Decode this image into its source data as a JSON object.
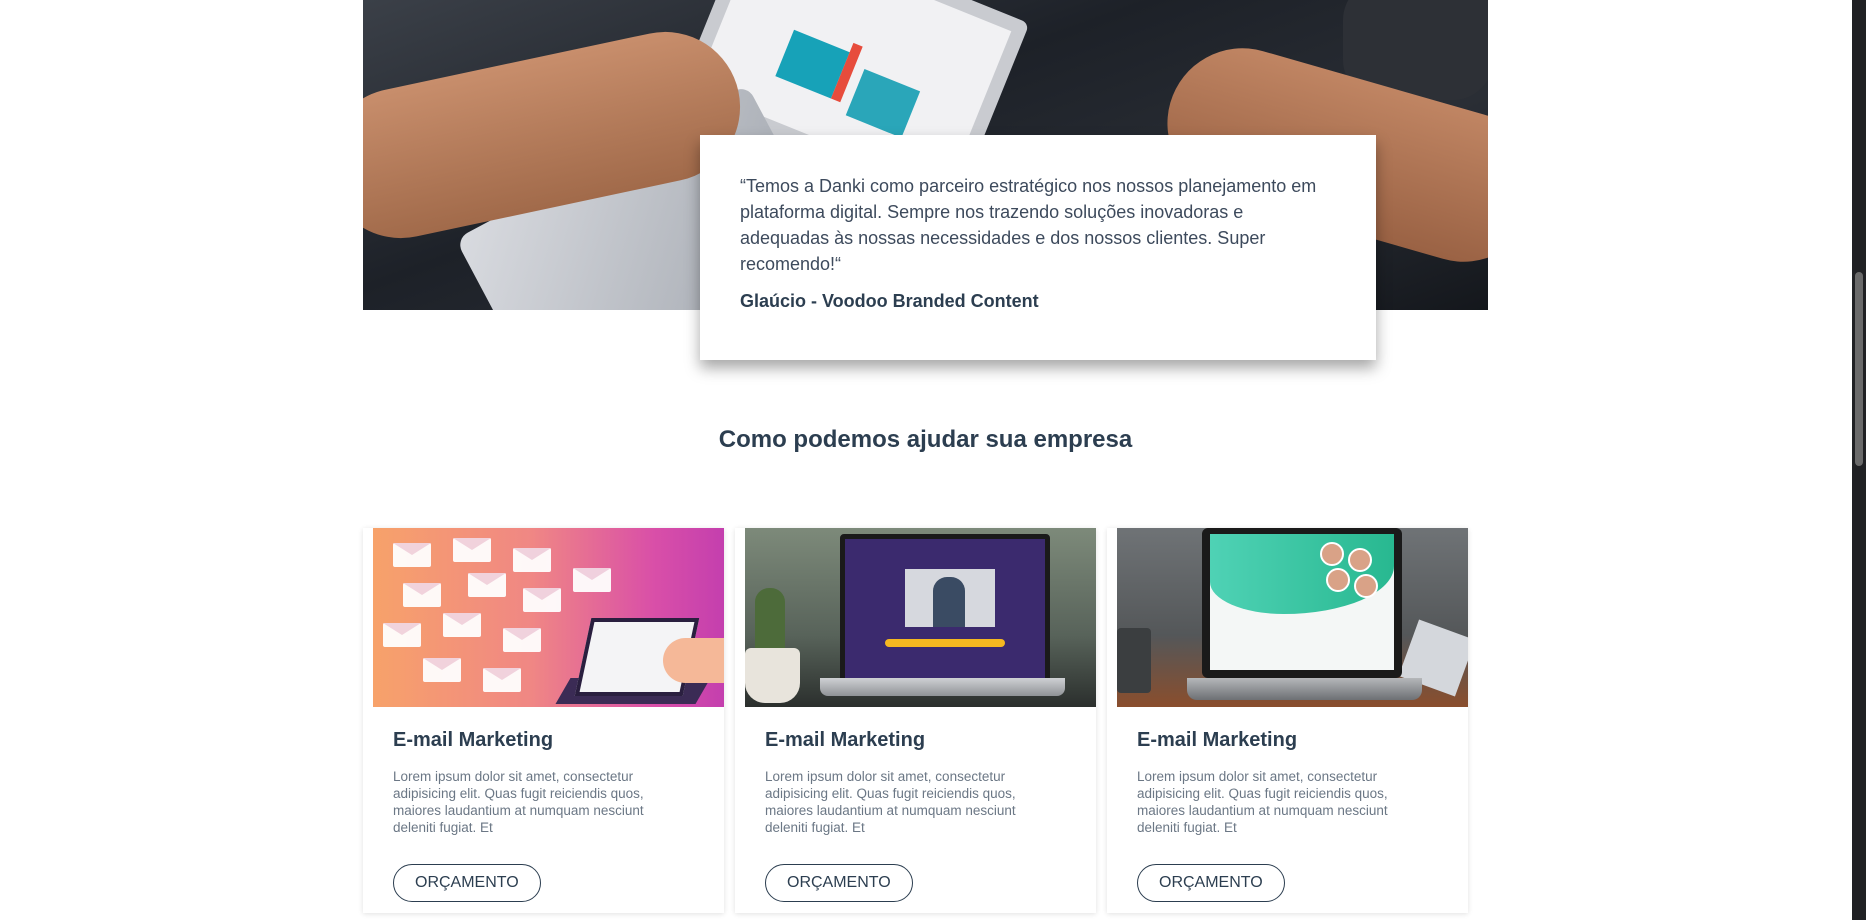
{
  "testimonial": {
    "quote": "“Temos a Danki como parceiro estratégico nos nossos planejamento em plataforma digital. Sempre nos trazendo soluções inovadoras e adequadas às nossas necessidades e dos nossos clientes. Super recomendo!“",
    "author": "Glaúcio - Voodoo Branded Content"
  },
  "section_title": "Como podemos ajudar sua empresa",
  "services": [
    {
      "title": "E-mail Marketing",
      "description": "Lorem ipsum dolor sit amet, consectetur adipisicing elit. Quas fugit reiciendis quos, maiores laudantium at numquam nesciunt deleniti fugiat. Et",
      "button": "ORÇAMENTO",
      "image_icon": "email-marketing-image"
    },
    {
      "title": "E-mail Marketing",
      "description": "Lorem ipsum dolor sit amet, consectetur adipisicing elit. Quas fugit reiciendis quos, maiores laudantium at numquam nesciunt deleniti fugiat. Et",
      "button": "ORÇAMENTO",
      "image_icon": "video-course-laptop-image"
    },
    {
      "title": "E-mail Marketing",
      "description": "Lorem ipsum dolor sit amet, consectetur adipisicing elit. Quas fugit reiciendis quos, maiores laudantium at numquam nesciunt deleniti fugiat. Et",
      "button": "ORÇAMENTO",
      "image_icon": "landing-page-laptop-image"
    }
  ],
  "colors": {
    "heading": "#2c3e50",
    "body_text": "#6b7785",
    "background": "#ffffff"
  }
}
